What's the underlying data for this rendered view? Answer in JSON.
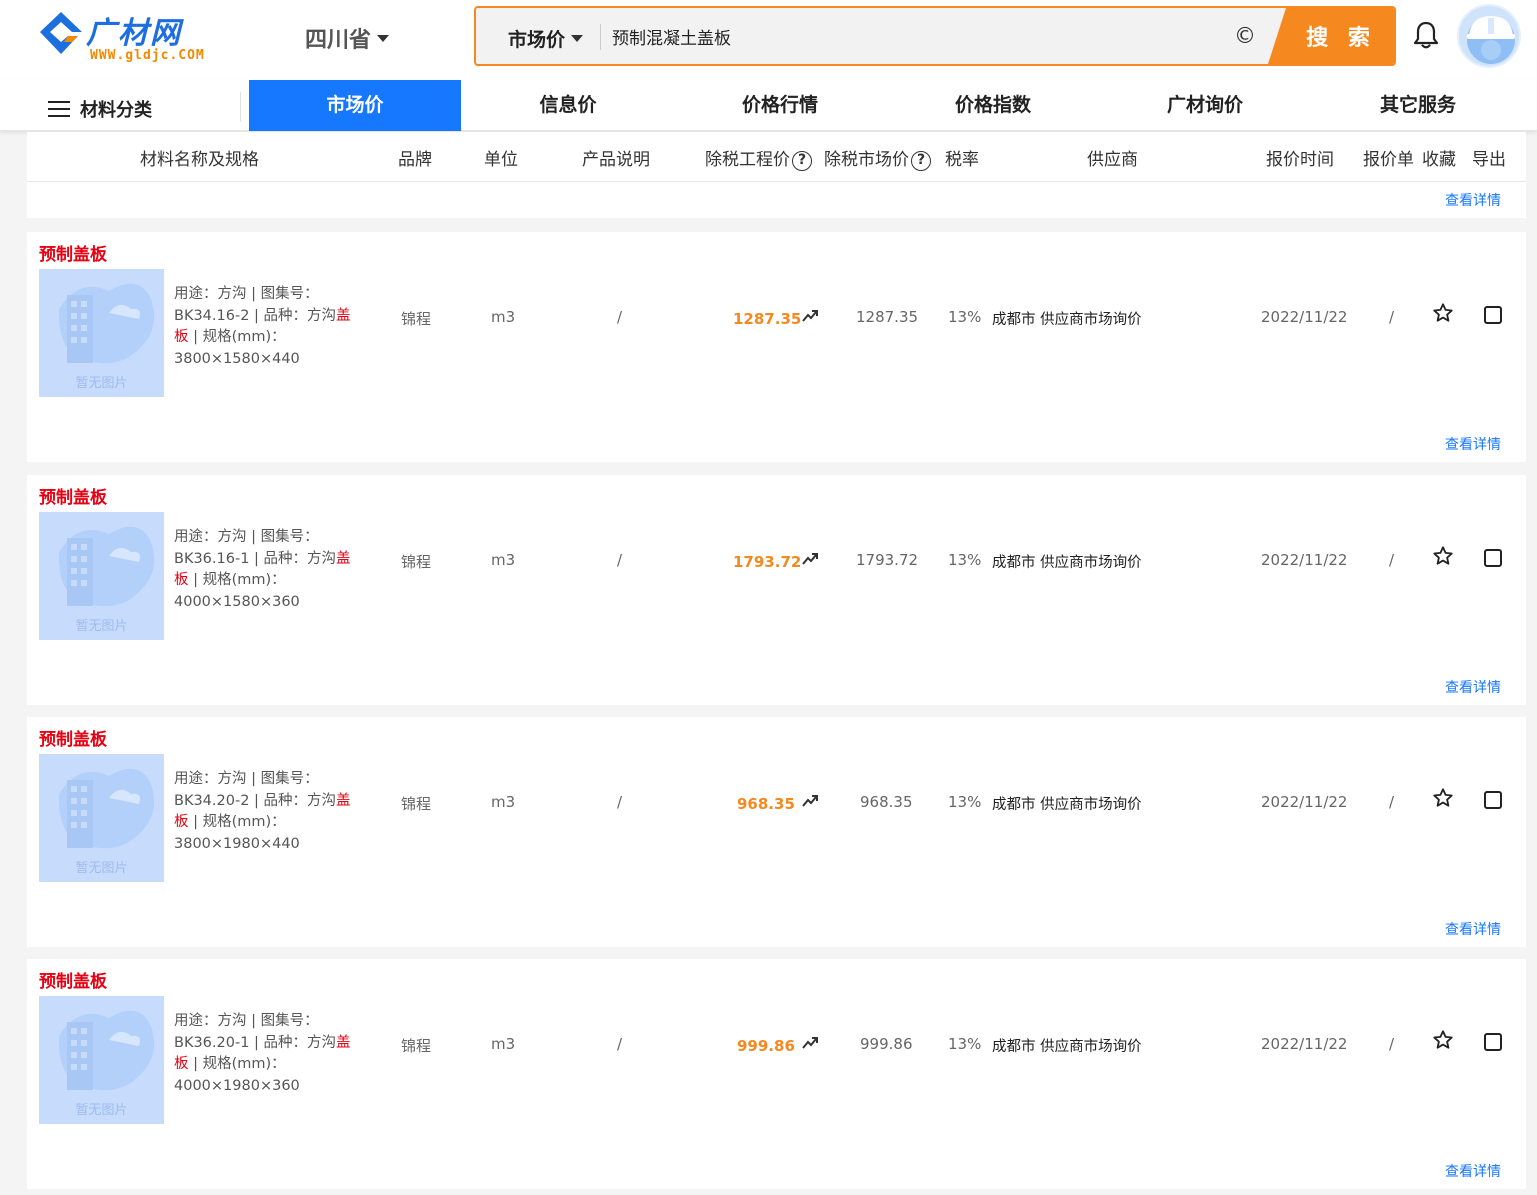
{
  "header": {
    "logo_text": "广材网",
    "logo_sub": "WWW.gldjc.COM",
    "province": "四川省",
    "search_type": "市场价",
    "search_value": "预制混凝土盖板",
    "clear_symbol": "©",
    "search_button": "搜 索",
    "accent_color": "#f5891f",
    "brand_color": "#1677ff"
  },
  "nav": {
    "category": "材料分类",
    "tabs": [
      "市场价",
      "信息价",
      "价格行情",
      "价格指数",
      "广材询价",
      "其它服务"
    ],
    "active_tab": "市场价"
  },
  "table_header": {
    "name": "材料名称及规格",
    "brand": "品牌",
    "unit": "单位",
    "desc": "产品说明",
    "eng_price": "除税工程价",
    "mkt_price": "除税市场价",
    "tax": "税率",
    "supplier": "供应商",
    "time": "报价时间",
    "quote": "报价单",
    "fav": "收藏",
    "export": "导出",
    "help_symbol": "?"
  },
  "detail_link": "查看详情",
  "no_image_text": "暂无图片",
  "rows": [
    {
      "title": "预制盖板",
      "desc_line1": "用途：方沟 | 图集号：",
      "desc_line2a": "BK34.16-2 | 品种：方沟",
      "desc_hl_a": "盖",
      "desc_hl_b": "板",
      "desc_line3": " | 规格(mm)：",
      "desc_line4": "3800×1580×440",
      "brand": "锦程",
      "unit": "m3",
      "product_desc": "/",
      "eng_price": "1287.35",
      "mkt_price": "1287.35",
      "tax": "13%",
      "supplier": "成都市 供应商市场询价",
      "time": "2022/11/22",
      "quote": "/"
    },
    {
      "title": "预制盖板",
      "desc_line1": "用途：方沟 | 图集号：",
      "desc_line2a": "BK36.16-1 | 品种：方沟",
      "desc_hl_a": "盖",
      "desc_hl_b": "板",
      "desc_line3": " | 规格(mm)：",
      "desc_line4": "4000×1580×360",
      "brand": "锦程",
      "unit": "m3",
      "product_desc": "/",
      "eng_price": "1793.72",
      "mkt_price": "1793.72",
      "tax": "13%",
      "supplier": "成都市 供应商市场询价",
      "time": "2022/11/22",
      "quote": "/"
    },
    {
      "title": "预制盖板",
      "desc_line1": "用途：方沟 | 图集号：",
      "desc_line2a": "BK34.20-2 | 品种：方沟",
      "desc_hl_a": "盖",
      "desc_hl_b": "板",
      "desc_line3": " | 规格(mm)：",
      "desc_line4": "3800×1980×440",
      "brand": "锦程",
      "unit": "m3",
      "product_desc": "/",
      "eng_price": "968.35",
      "mkt_price": "968.35",
      "tax": "13%",
      "supplier": "成都市 供应商市场询价",
      "time": "2022/11/22",
      "quote": "/"
    },
    {
      "title": "预制盖板",
      "desc_line1": "用途：方沟 | 图集号：",
      "desc_line2a": "BK36.20-1 | 品种：方沟",
      "desc_hl_a": "盖",
      "desc_hl_b": "板",
      "desc_line3": " | 规格(mm)：",
      "desc_line4": "4000×1980×360",
      "brand": "锦程",
      "unit": "m3",
      "product_desc": "/",
      "eng_price": "999.86",
      "mkt_price": "999.86",
      "tax": "13%",
      "supplier": "成都市 供应商市场询价",
      "time": "2022/11/22",
      "quote": "/"
    }
  ]
}
